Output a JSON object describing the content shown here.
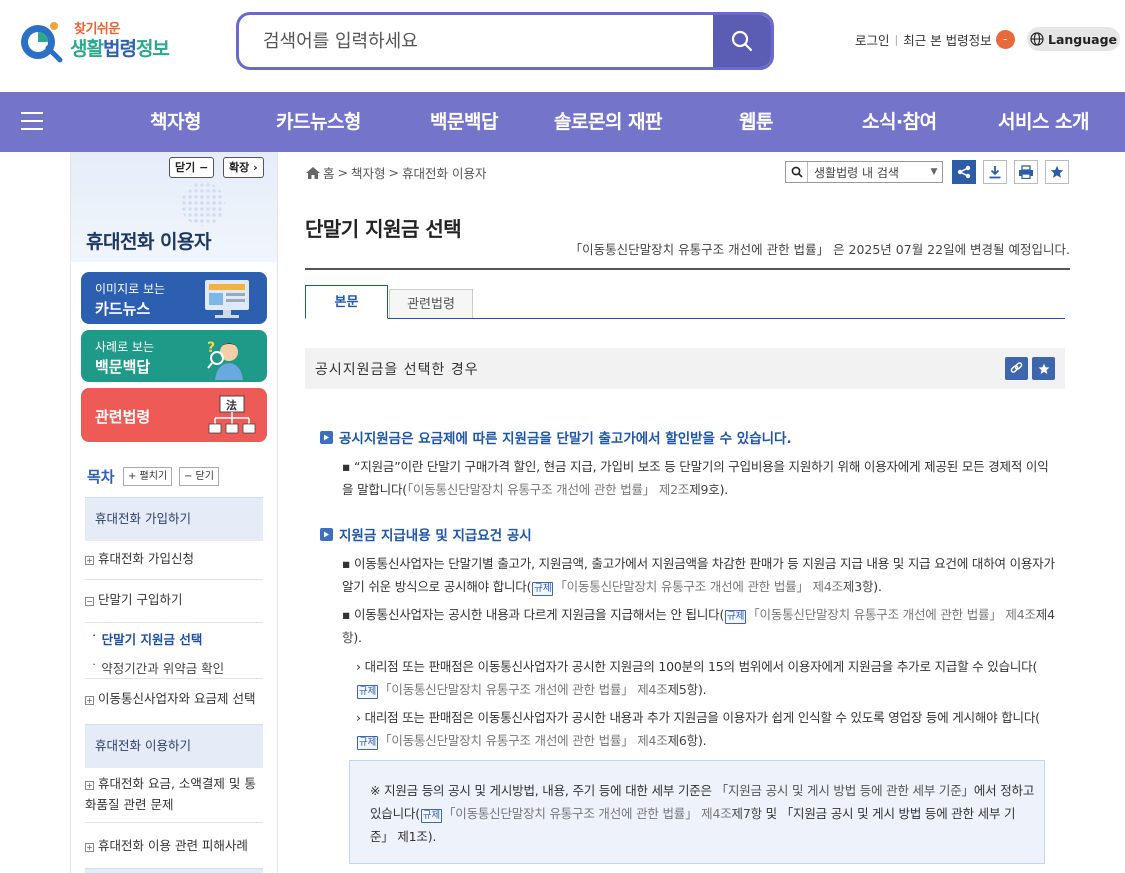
{
  "header": {
    "logo_small": "찾기쉬운",
    "logo_big_1": "생활",
    "logo_big_2": "법령",
    "logo_big_3": "정보",
    "search_placeholder": "검색어를 입력하세요",
    "login": "로그인",
    "recent": "최근 본 법령정보",
    "recent_count": "-",
    "language": "Language"
  },
  "nav": {
    "items": [
      "책자형",
      "카드뉴스형",
      "백문백답",
      "솔로몬의 재판",
      "웹툰",
      "소식·참여",
      "서비스 소개"
    ]
  },
  "sidebar": {
    "close_btn": "닫기 −",
    "expand_btn": "확장 ›",
    "title": "휴대전화 이용자",
    "promo_card_small": "이미지로 보는",
    "promo_card_big": "카드뉴스",
    "promo_qa_small": "사례로 보는",
    "promo_qa_big": "백문백답",
    "promo_law_big": "관련법령",
    "promo_law_icon_text": "法",
    "toc_title": "목차",
    "toc_expand": "+ 펼치기",
    "toc_collapse": "− 닫기",
    "sec1": "휴대전화 가입하기",
    "item1": "휴대전화 가입신청",
    "item2": "단말기 구입하기",
    "sub1": "단말기 지원금 선택",
    "sub2": "약정기간과 위약금 확인",
    "item3": "이동통신사업자와 요금제 선택",
    "sec2": "휴대전화 이용하기",
    "item4": "휴대전화 요금, 소액결제 및 통화품질 관련 문제",
    "item5": "휴대전화 이용 관련 피해사례"
  },
  "breadcrumb": {
    "home": "홈",
    "level1": "책자형",
    "level2": "휴대전화 이용자"
  },
  "tools": {
    "search_label": "생활법령 내 검색"
  },
  "page": {
    "title": "단말기 지원금 선택",
    "notice": "「이동통신단말장치 유통구조 개선에 관한 법률」 은 2025년 07월 22일에 변경될 예정입니다.",
    "tab_main": "본문",
    "tab_law": "관련법령",
    "section_title": "공시지원금을 선택한 경우"
  },
  "content": {
    "h1": "공시지원금은 요금제에 따른 지원금을 단말기 출고가에서 할인받을 수 있습니다.",
    "p1_text": "“지원금”이란 단말기 구매가격 할인, 현금 지급, 가입비 보조 등 단말기의 구입비용을 지원하기 위해 이용자에게 제공된 모든 경제적 이익을 말합니다(",
    "p1_law": "「이동통신단말장치 유통구조 개선에 관한 법률」 제2조",
    "p1_art": "제9호",
    "p1_end": ").",
    "h2": "지원금 지급내용 및 지급요건 공시",
    "p2_text": "이동통신사업자는 단말기별 출고가, 지원금액, 출고가에서 지원금액을 차감한 판매가 등 지원금 지급 내용 및 지급 요건에 대하여 이용자가 알기 쉬운 방식으로 공시해야 합니다(",
    "tag": "규제",
    "p2_law": "「이동통신단말장치 유통구조 개선에 관한 법률」 제4조",
    "p2_art": "제3항",
    "p2_end": ").",
    "p3_text": "이동통신사업자는 공시한 내용과 다르게 지원금을 지급해서는 안 됩니다(",
    "p3_law": "「이동통신단말장치 유통구조 개선에 관한 법률」 제4조",
    "p3_art": "제4항",
    "p3_end": ").",
    "p4_text": "대리점 또는 판매점은 이동통신사업자가 공시한 지원금의 100분의 15의 범위에서 이용자에게 지원금을 추가로 지급할 수 있습니다(",
    "p4_law": "「이동통신단말장치 유통구조 개선에 관한 법률」 제4조",
    "p4_art": "제5항",
    "p4_end": ").",
    "p5_text": "대리점 또는 판매점은 이동통신사업자가 공시한 내용과 추가 지원금을 이용자가 쉽게 인식할 수 있도록 영업장 등에 게시해야 합니다(",
    "p5_law": "「이동통신단말장치 유통구조 개선에 관한 법률」 제4조",
    "p5_art": "제6항",
    "p5_end": ").",
    "note_mark": "※",
    "note_text1": "지원금 등의 공시 및 게시방법, 내용, 주기 등에 대한 세부 기준은",
    "note_ref": "「지원금 공시 및 게시 방법 등에 관한 세부 기준」",
    "note_text2": "에서 정하고 있습니다(",
    "note_law": "「이동통신단말장치 유통구조 개선에 관한 법률」 제4조",
    "note_art": "제7항",
    "note_text3": "및 「지원금 공시 및 게시 방법 등에 관한 세부 기준」 제1조)."
  },
  "colors": {
    "nav_bg": "#7474cb",
    "search_border": "#6a6bc8",
    "accent_blue": "#1e56a8",
    "promo_card": "#2d5fb0",
    "promo_qa": "#1f9a88",
    "promo_law": "#ee5a55"
  }
}
